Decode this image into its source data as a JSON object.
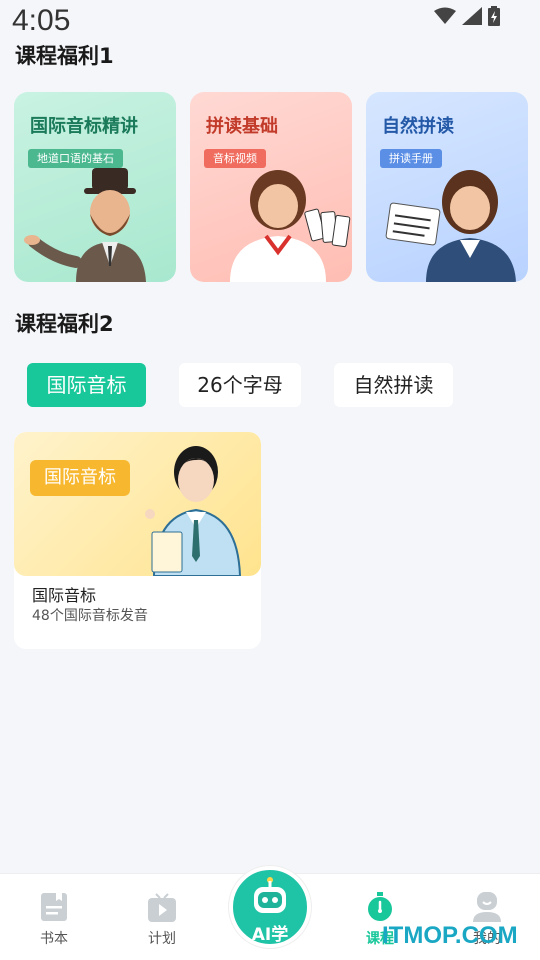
{
  "status": {
    "time": "4:05"
  },
  "welfare1": {
    "title": "课程福利1",
    "cards": [
      {
        "title": "国际音标精讲",
        "tag": "地道口语的基石"
      },
      {
        "title": "拼读基础",
        "tag": "音标视频"
      },
      {
        "title": "自然拼读",
        "tag": "拼读手册"
      }
    ]
  },
  "welfare2": {
    "title": "课程福利2",
    "tabs": [
      "国际音标",
      "26个字母",
      "自然拼读"
    ],
    "course": {
      "badge": "国际音标",
      "title": "国际音标",
      "subtitle": "48个国际音标发音"
    }
  },
  "nav": {
    "books": "书本",
    "plan": "计划",
    "ai": "AI学",
    "course": "课程",
    "mine": "我的"
  },
  "watermark": "ITMOP.COM",
  "colors": {
    "accent": "#18c79a",
    "badge": "#f7b72e"
  }
}
